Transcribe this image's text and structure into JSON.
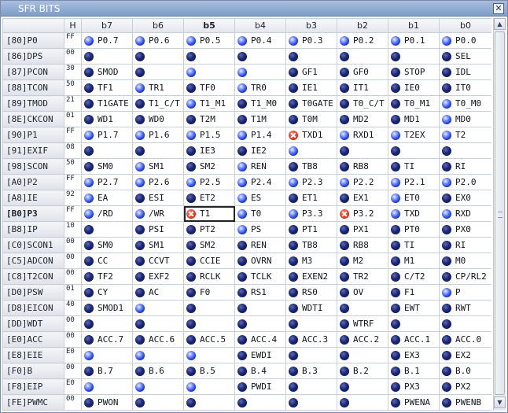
{
  "window": {
    "title": "SFR BITS",
    "close_glyph": "✕"
  },
  "header": {
    "h_label": "H",
    "bits": [
      "b7",
      "b6",
      "b5",
      "b4",
      "b3",
      "b2",
      "b1",
      "b0"
    ],
    "selected_bit_index": 2
  },
  "selected_register": "[B0]P3",
  "registers": [
    {
      "name": "[80]P0",
      "hex": "FF",
      "bits": [
        {
          "label": "P0.7",
          "state": "on"
        },
        {
          "label": "P0.6",
          "state": "on"
        },
        {
          "label": "P0.5",
          "state": "on"
        },
        {
          "label": "P0.4",
          "state": "on"
        },
        {
          "label": "P0.3",
          "state": "on"
        },
        {
          "label": "P0.2",
          "state": "on"
        },
        {
          "label": "P0.1",
          "state": "on"
        },
        {
          "label": "P0.0",
          "state": "on"
        }
      ]
    },
    {
      "name": "[86]DPS",
      "hex": "00",
      "bits": [
        {
          "label": "",
          "state": "off"
        },
        {
          "label": "",
          "state": "off"
        },
        {
          "label": "",
          "state": "off"
        },
        {
          "label": "",
          "state": "off"
        },
        {
          "label": "",
          "state": "off"
        },
        {
          "label": "",
          "state": "off"
        },
        {
          "label": "",
          "state": "off"
        },
        {
          "label": "SEL",
          "state": "off"
        }
      ]
    },
    {
      "name": "[87]PCON",
      "hex": "30",
      "bits": [
        {
          "label": "SMOD",
          "state": "off"
        },
        {
          "label": "",
          "state": "off"
        },
        {
          "label": "",
          "state": "on"
        },
        {
          "label": "",
          "state": "on"
        },
        {
          "label": "GF1",
          "state": "off"
        },
        {
          "label": "GF0",
          "state": "off"
        },
        {
          "label": "STOP",
          "state": "off"
        },
        {
          "label": "IDL",
          "state": "off"
        }
      ]
    },
    {
      "name": "[88]TCON",
      "hex": "50",
      "bits": [
        {
          "label": "TF1",
          "state": "off"
        },
        {
          "label": "TR1",
          "state": "on"
        },
        {
          "label": "TF0",
          "state": "off"
        },
        {
          "label": "TR0",
          "state": "on"
        },
        {
          "label": "IE1",
          "state": "off"
        },
        {
          "label": "IT1",
          "state": "off"
        },
        {
          "label": "IE0",
          "state": "off"
        },
        {
          "label": "IT0",
          "state": "off"
        }
      ]
    },
    {
      "name": "[89]TMOD",
      "hex": "21",
      "bits": [
        {
          "label": "T1GATE",
          "state": "off"
        },
        {
          "label": "T1_C/T",
          "state": "off"
        },
        {
          "label": "T1_M1",
          "state": "on"
        },
        {
          "label": "T1_M0",
          "state": "off"
        },
        {
          "label": "T0GATE",
          "state": "off"
        },
        {
          "label": "T0_C/T",
          "state": "off"
        },
        {
          "label": "T0_M1",
          "state": "off"
        },
        {
          "label": "T0_M0",
          "state": "on"
        }
      ]
    },
    {
      "name": "[8E]CKCON",
      "hex": "01",
      "bits": [
        {
          "label": "WD1",
          "state": "off"
        },
        {
          "label": "WD0",
          "state": "off"
        },
        {
          "label": "T2M",
          "state": "off"
        },
        {
          "label": "T1M",
          "state": "off"
        },
        {
          "label": "T0M",
          "state": "off"
        },
        {
          "label": "MD2",
          "state": "off"
        },
        {
          "label": "MD1",
          "state": "off"
        },
        {
          "label": "MD0",
          "state": "on"
        }
      ]
    },
    {
      "name": "[90]P1",
      "hex": "FF",
      "bits": [
        {
          "label": "P1.7",
          "state": "on"
        },
        {
          "label": "P1.6",
          "state": "on"
        },
        {
          "label": "P1.5",
          "state": "on"
        },
        {
          "label": "P1.4",
          "state": "on"
        },
        {
          "label": "TXD1",
          "state": "err"
        },
        {
          "label": "RXD1",
          "state": "on"
        },
        {
          "label": "T2EX",
          "state": "on"
        },
        {
          "label": "T2",
          "state": "on"
        }
      ]
    },
    {
      "name": "[91]EXIF",
      "hex": "08",
      "bits": [
        {
          "label": "",
          "state": "off"
        },
        {
          "label": "",
          "state": "off"
        },
        {
          "label": "IE3",
          "state": "off"
        },
        {
          "label": "IE2",
          "state": "off"
        },
        {
          "label": "",
          "state": "on"
        },
        {
          "label": "",
          "state": "off"
        },
        {
          "label": "",
          "state": "off"
        },
        {
          "label": "",
          "state": "off"
        }
      ]
    },
    {
      "name": "[98]SCON",
      "hex": "50",
      "bits": [
        {
          "label": "SM0",
          "state": "off"
        },
        {
          "label": "SM1",
          "state": "on"
        },
        {
          "label": "SM2",
          "state": "off"
        },
        {
          "label": "REN",
          "state": "on"
        },
        {
          "label": "TB8",
          "state": "off"
        },
        {
          "label": "RB8",
          "state": "off"
        },
        {
          "label": "TI",
          "state": "off"
        },
        {
          "label": "RI",
          "state": "off"
        }
      ]
    },
    {
      "name": "[A0]P2",
      "hex": "FF",
      "bits": [
        {
          "label": "P2.7",
          "state": "on"
        },
        {
          "label": "P2.6",
          "state": "on"
        },
        {
          "label": "P2.5",
          "state": "on"
        },
        {
          "label": "P2.4",
          "state": "on"
        },
        {
          "label": "P2.3",
          "state": "on"
        },
        {
          "label": "P2.2",
          "state": "on"
        },
        {
          "label": "P2.1",
          "state": "on"
        },
        {
          "label": "P2.0",
          "state": "on"
        }
      ]
    },
    {
      "name": "[A8]IE",
      "hex": "92",
      "bits": [
        {
          "label": "EA",
          "state": "on"
        },
        {
          "label": "ESI",
          "state": "off"
        },
        {
          "label": "ET2",
          "state": "off"
        },
        {
          "label": "ES",
          "state": "on"
        },
        {
          "label": "ET1",
          "state": "off"
        },
        {
          "label": "EX1",
          "state": "off"
        },
        {
          "label": "ET0",
          "state": "on"
        },
        {
          "label": "EX0",
          "state": "off"
        }
      ]
    },
    {
      "name": "[B0]P3",
      "hex": "FF",
      "bits": [
        {
          "label": "/RD",
          "state": "on"
        },
        {
          "label": "/WR",
          "state": "on"
        },
        {
          "label": "T1",
          "state": "err"
        },
        {
          "label": "T0",
          "state": "on"
        },
        {
          "label": "P3.3",
          "state": "on"
        },
        {
          "label": "P3.2",
          "state": "err"
        },
        {
          "label": "TXD",
          "state": "on"
        },
        {
          "label": "RXD",
          "state": "on"
        }
      ]
    },
    {
      "name": "[B8]IP",
      "hex": "10",
      "bits": [
        {
          "label": "",
          "state": "off"
        },
        {
          "label": "PSI",
          "state": "off"
        },
        {
          "label": "PT2",
          "state": "off"
        },
        {
          "label": "PS",
          "state": "on"
        },
        {
          "label": "PT1",
          "state": "off"
        },
        {
          "label": "PX1",
          "state": "off"
        },
        {
          "label": "PT0",
          "state": "off"
        },
        {
          "label": "PX0",
          "state": "off"
        }
      ]
    },
    {
      "name": "[C0]SCON1",
      "hex": "00",
      "bits": [
        {
          "label": "SM0",
          "state": "off"
        },
        {
          "label": "SM1",
          "state": "off"
        },
        {
          "label": "SM2",
          "state": "off"
        },
        {
          "label": "REN",
          "state": "off"
        },
        {
          "label": "TB8",
          "state": "off"
        },
        {
          "label": "RB8",
          "state": "off"
        },
        {
          "label": "TI",
          "state": "off"
        },
        {
          "label": "RI",
          "state": "off"
        }
      ]
    },
    {
      "name": "[C5]ADCON",
      "hex": "00",
      "bits": [
        {
          "label": "CC",
          "state": "off"
        },
        {
          "label": "CCVT",
          "state": "off"
        },
        {
          "label": "CCIE",
          "state": "off"
        },
        {
          "label": "OVRN",
          "state": "off"
        },
        {
          "label": "M3",
          "state": "off"
        },
        {
          "label": "M2",
          "state": "off"
        },
        {
          "label": "M1",
          "state": "off"
        },
        {
          "label": "M0",
          "state": "off"
        }
      ]
    },
    {
      "name": "[C8]T2CON",
      "hex": "00",
      "bits": [
        {
          "label": "TF2",
          "state": "off"
        },
        {
          "label": "EXF2",
          "state": "off"
        },
        {
          "label": "RCLK",
          "state": "off"
        },
        {
          "label": "TCLK",
          "state": "off"
        },
        {
          "label": "EXEN2",
          "state": "off"
        },
        {
          "label": "TR2",
          "state": "off"
        },
        {
          "label": "C/T2",
          "state": "off"
        },
        {
          "label": "CP/RL2",
          "state": "off"
        }
      ]
    },
    {
      "name": "[D0]PSW",
      "hex": "01",
      "bits": [
        {
          "label": "CY",
          "state": "off"
        },
        {
          "label": "AC",
          "state": "off"
        },
        {
          "label": "F0",
          "state": "off"
        },
        {
          "label": "RS1",
          "state": "off"
        },
        {
          "label": "RS0",
          "state": "off"
        },
        {
          "label": "OV",
          "state": "off"
        },
        {
          "label": "F1",
          "state": "off"
        },
        {
          "label": "P",
          "state": "on"
        }
      ]
    },
    {
      "name": "[D8]EICON",
      "hex": "40",
      "bits": [
        {
          "label": "SMOD1",
          "state": "off"
        },
        {
          "label": "",
          "state": "on"
        },
        {
          "label": "",
          "state": "off"
        },
        {
          "label": "",
          "state": "off"
        },
        {
          "label": "WDTI",
          "state": "off"
        },
        {
          "label": "",
          "state": "off"
        },
        {
          "label": "EWT",
          "state": "off"
        },
        {
          "label": "RWT",
          "state": "off"
        }
      ]
    },
    {
      "name": "[DD]WDT",
      "hex": "00",
      "bits": [
        {
          "label": "",
          "state": "off"
        },
        {
          "label": "",
          "state": "off"
        },
        {
          "label": "",
          "state": "off"
        },
        {
          "label": "",
          "state": "off"
        },
        {
          "label": "",
          "state": "off"
        },
        {
          "label": "WTRF",
          "state": "off"
        },
        {
          "label": "",
          "state": "off"
        },
        {
          "label": "",
          "state": "off"
        }
      ]
    },
    {
      "name": "[E0]ACC",
      "hex": "00",
      "bits": [
        {
          "label": "ACC.7",
          "state": "off"
        },
        {
          "label": "ACC.6",
          "state": "off"
        },
        {
          "label": "ACC.5",
          "state": "off"
        },
        {
          "label": "ACC.4",
          "state": "off"
        },
        {
          "label": "ACC.3",
          "state": "off"
        },
        {
          "label": "ACC.2",
          "state": "off"
        },
        {
          "label": "ACC.1",
          "state": "off"
        },
        {
          "label": "ACC.0",
          "state": "off"
        }
      ]
    },
    {
      "name": "[E8]EIE",
      "hex": "E0",
      "bits": [
        {
          "label": "",
          "state": "on"
        },
        {
          "label": "",
          "state": "on"
        },
        {
          "label": "",
          "state": "on"
        },
        {
          "label": "EWDI",
          "state": "off"
        },
        {
          "label": "",
          "state": "off"
        },
        {
          "label": "",
          "state": "off"
        },
        {
          "label": "EX3",
          "state": "off"
        },
        {
          "label": "EX2",
          "state": "off"
        }
      ]
    },
    {
      "name": "[F0]B",
      "hex": "00",
      "bits": [
        {
          "label": "B.7",
          "state": "off"
        },
        {
          "label": "B.6",
          "state": "off"
        },
        {
          "label": "B.5",
          "state": "off"
        },
        {
          "label": "B.4",
          "state": "off"
        },
        {
          "label": "B.3",
          "state": "off"
        },
        {
          "label": "B.2",
          "state": "off"
        },
        {
          "label": "B.1",
          "state": "off"
        },
        {
          "label": "B.0",
          "state": "off"
        }
      ]
    },
    {
      "name": "[F8]EIP",
      "hex": "E0",
      "bits": [
        {
          "label": "",
          "state": "on"
        },
        {
          "label": "",
          "state": "on"
        },
        {
          "label": "",
          "state": "on"
        },
        {
          "label": "PWDI",
          "state": "off"
        },
        {
          "label": "",
          "state": "off"
        },
        {
          "label": "",
          "state": "off"
        },
        {
          "label": "PX3",
          "state": "off"
        },
        {
          "label": "PX2",
          "state": "off"
        }
      ]
    },
    {
      "name": "[FE]PWMC",
      "hex": "00",
      "bits": [
        {
          "label": "PWON",
          "state": "off"
        },
        {
          "label": "",
          "state": "off"
        },
        {
          "label": "",
          "state": "off"
        },
        {
          "label": "",
          "state": "off"
        },
        {
          "label": "",
          "state": "off"
        },
        {
          "label": "",
          "state": "off"
        },
        {
          "label": "PWENA",
          "state": "off"
        },
        {
          "label": "PWENB",
          "state": "off"
        }
      ]
    }
  ],
  "active_cell": {
    "register": "[B0]P3",
    "bit": "b5"
  },
  "scrollbar": {
    "up_glyph": "▲",
    "down_glyph": "▼"
  }
}
